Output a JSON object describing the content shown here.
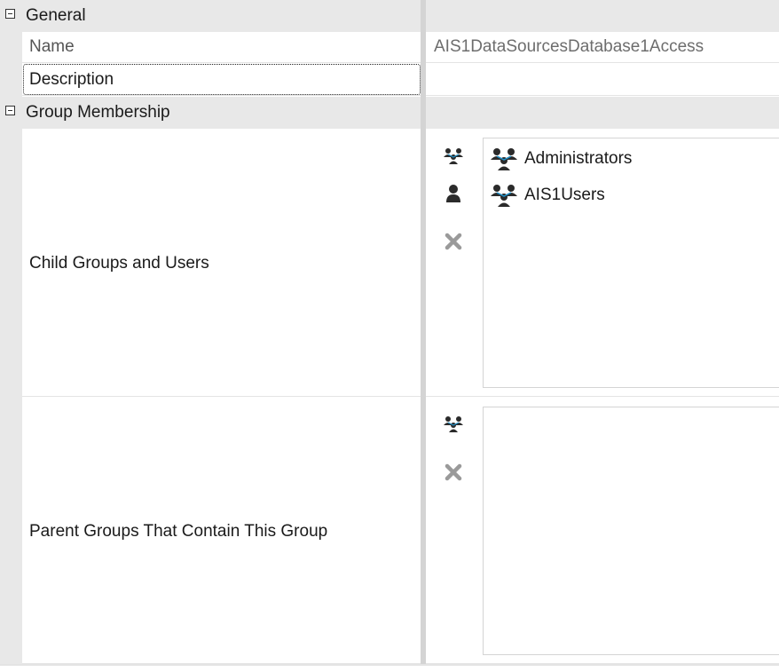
{
  "categories": {
    "general": {
      "label": "General"
    },
    "group_membership": {
      "label": "Group Membership"
    }
  },
  "properties": {
    "name": {
      "label": "Name",
      "value": "AIS1DataSourcesDatabase1Access"
    },
    "description": {
      "label": "Description",
      "value": ""
    },
    "child_groups": {
      "label": "Child Groups and Users",
      "actions": [
        "add-group-icon",
        "add-user-icon",
        "remove-icon"
      ],
      "items": [
        {
          "label": "Administrators",
          "icon": "group-icon"
        },
        {
          "label": "AIS1Users",
          "icon": "group-icon"
        }
      ]
    },
    "parent_groups": {
      "label": "Parent Groups That Contain This Group",
      "actions": [
        "add-group-icon",
        "remove-icon"
      ],
      "items": []
    }
  },
  "colors": {
    "gutter": "#e8e8e8",
    "splitter": "#d4d4d4",
    "group_icon_accent": "#1e90c8",
    "remove_icon": "#9a9a9a",
    "value_text": "#6d6d6d"
  }
}
